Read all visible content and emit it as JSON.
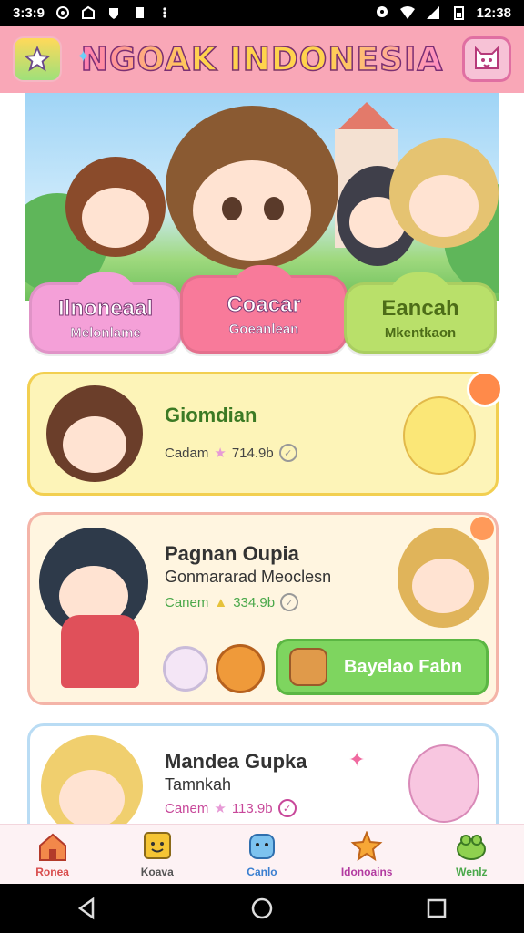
{
  "status_bar": {
    "time": "3:3:9",
    "clock": "12:38"
  },
  "header": {
    "title": "NGOAK INDONESIA"
  },
  "categories": [
    {
      "title": "Ilnoneaal",
      "subtitle": "Melonlame",
      "color": "#f4a0d8"
    },
    {
      "title": "Coacar",
      "subtitle": "Goeanlean",
      "color": "#f87a9a"
    },
    {
      "title": "Eancah",
      "subtitle": "Mkentkaon",
      "color": "#b9e06a"
    }
  ],
  "cards": [
    {
      "name": "Giomdian",
      "subtitle": "",
      "meta_label": "Cadam",
      "meta_value": "714.9b"
    },
    {
      "name": "Pagnan Oupia",
      "subtitle": "Gonmararad Meoclesn",
      "meta_label": "Canem",
      "meta_value": "334.9b",
      "action_label": "Bayelao Fabn"
    },
    {
      "name": "Mandea Gupka",
      "subtitle": "Tamnkah",
      "meta_label": "Canem",
      "meta_value": "113.9b"
    }
  ],
  "bottom_nav": [
    {
      "label": "Ronea",
      "icon": "house-icon",
      "color": "#d94c4c"
    },
    {
      "label": "Koava",
      "icon": "smiley-box-icon",
      "color": "#555555"
    },
    {
      "label": "Canlo",
      "icon": "blue-pet-icon",
      "color": "#3a7fd0"
    },
    {
      "label": "Idonoains",
      "icon": "star-icon",
      "color": "#b23aa0"
    },
    {
      "label": "Wenlz",
      "icon": "green-frog-icon",
      "color": "#4aa84a"
    }
  ],
  "colors": {
    "header": "#f9a7b7",
    "accent_green": "#7ed55f",
    "card_yellow": "#fdf4b8"
  }
}
